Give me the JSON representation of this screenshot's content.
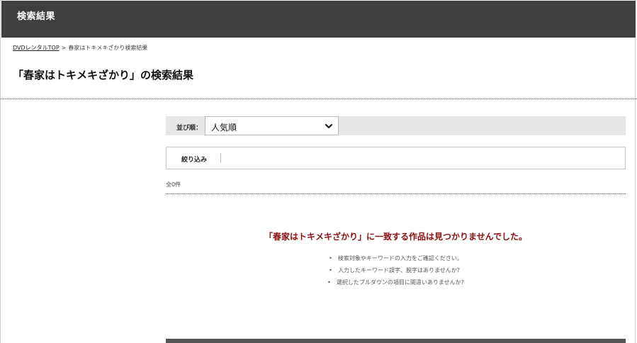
{
  "header": {
    "title": "検索結果"
  },
  "breadcrumb": {
    "home_label": "DVDレンタルTOP",
    "separator": ">",
    "current": "春家はトキメキざかり検索結果"
  },
  "page_title": "「春家はトキメキざかり」の検索結果",
  "sort": {
    "label": "並び順：",
    "selected": "人気順"
  },
  "filter": {
    "label": "絞り込み"
  },
  "result_count": "全0件",
  "no_result_message": "「春家はトキメキざかり」に一致する作品は見つかりませんでした。",
  "hints": [
    "検索対象やキーワードの入力をご確認ください。",
    "入力したキーワード誤字、脱字はありませんか？",
    "選択したプルダウンの項目に間違いありませんか?"
  ],
  "icons": {
    "sort_dropdown": "chevron-down-icon"
  },
  "colors": {
    "header_bg": "#3f3f3f",
    "sort_bar_bg": "#e6e6e6",
    "no_result_text": "#8b0f0f"
  }
}
